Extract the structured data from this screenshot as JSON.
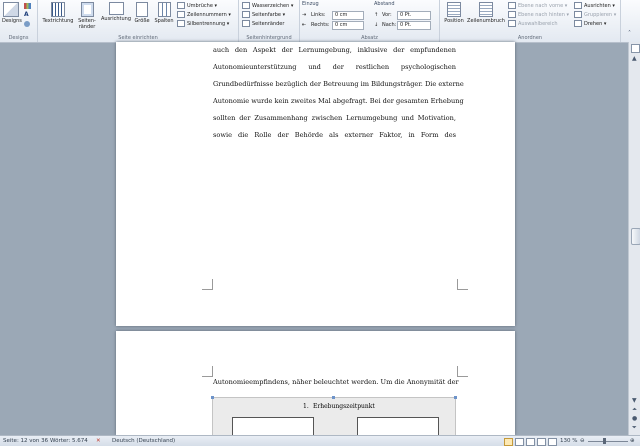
{
  "ribbon": {
    "designs": {
      "button": "Designs",
      "group": "Designs"
    },
    "page_setup": {
      "group": "Seite einrichten",
      "buttons": [
        "Textrichtung",
        "Seiten-\nränder",
        "Ausrichtung",
        "Größe",
        "Spalten"
      ],
      "small": [
        "Umbrüche",
        "Zeilennummern",
        "Silbentrennung"
      ]
    },
    "page_background": {
      "group": "Seitenhintergrund",
      "small": [
        "Wasserzeichen",
        "Seitenfarbe",
        "Seitenränder"
      ]
    },
    "paragraph": {
      "group": "Absatz",
      "einzug": "Einzug",
      "abstand": "Abstand",
      "links_label": "Links:",
      "links_value": "0 cm",
      "rechts_label": "Rechts:",
      "rechts_value": "0 cm",
      "vor_label": "Vor:",
      "vor_value": "0 Pt.",
      "nach_label": "Nach:",
      "nach_value": "0 Pt."
    },
    "arrange": {
      "group": "Anordnen",
      "position": "Position",
      "wrap": "Zeilenumbruch",
      "small_mid": [
        "Ebene nach vorne",
        "Ebene nach hinten",
        "Auswahlbereich"
      ],
      "small_right": [
        "Ausrichten",
        "Gruppieren",
        "Drehen"
      ]
    }
  },
  "document": {
    "page1_lines": [
      "auch den Aspekt der Lernumgebung, inklusive der empfundenen",
      "Autonomieunterstützung und der restlichen psychologischen",
      "Grundbedürfnisse bezüglich der Betreuung im Bildungsträger. Die externe",
      "Autonomie wurde kein zweites Mal abgefragt. Bei der gesamten Erhebung",
      "sollten der Zusammenhang zwischen Lernumgebung und Motivation,",
      "sowie die Rolle der Behörde als externer Faktor, in Form des"
    ],
    "page2_lines": [
      "Autonomieempfindens, näher beleuchtet werden. Um die Anonymität der"
    ],
    "diagram": {
      "number": "1.",
      "title": "Erhebungszeitpunkt"
    }
  },
  "statusbar": {
    "page": "Seite: 12 von 36",
    "words": "Wörter: 5.674",
    "language": "Deutsch (Deutschland)",
    "zoom": "130 %"
  }
}
